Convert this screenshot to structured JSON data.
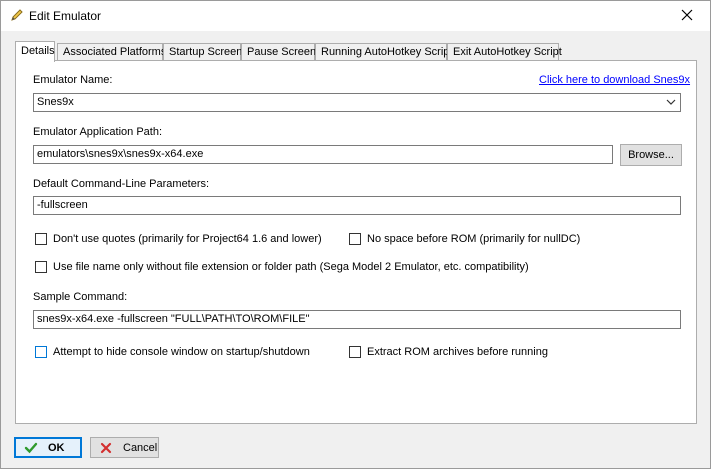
{
  "window": {
    "title": "Edit Emulator",
    "title_icon": "pencil-icon",
    "close_icon": "close-icon"
  },
  "tabs": [
    {
      "label": "Details",
      "active": true
    },
    {
      "label": "Associated Platforms",
      "active": false
    },
    {
      "label": "Startup Screen",
      "active": false
    },
    {
      "label": "Pause Screen",
      "active": false
    },
    {
      "label": "Running AutoHotkey Script",
      "active": false
    },
    {
      "label": "Exit AutoHotkey Script",
      "active": false
    }
  ],
  "details": {
    "emulator_name_label": "Emulator Name:",
    "download_link": "Click here to download Snes9x",
    "emulator_name_value": "Snes9x",
    "app_path_label": "Emulator Application Path:",
    "app_path_value": "emulators\\snes9x\\snes9x-x64.exe",
    "browse_label": "Browse...",
    "cmdline_label": "Default Command-Line Parameters:",
    "cmdline_value": "-fullscreen",
    "checkbox_no_quotes": "Don't use quotes (primarily for Project64 1.6 and lower)",
    "checkbox_no_space": "No space before ROM (primarily for nullDC)",
    "checkbox_file_name_only": "Use file name only without file extension or folder path (Sega Model 2 Emulator, etc. compatibility)",
    "sample_label": "Sample Command:",
    "sample_value": "snes9x-x64.exe -fullscreen \"FULL\\PATH\\TO\\ROM\\FILE\"",
    "checkbox_hide_console": "Attempt to hide console window on startup/shutdown",
    "checkbox_extract_rom": "Extract ROM archives before running"
  },
  "footer": {
    "ok_label": "OK",
    "cancel_label": "Cancel"
  },
  "colors": {
    "accent": "#0078d7",
    "link": "#0000ff",
    "ok_check": "#2e9a2e",
    "cancel_x": "#d32f2f"
  }
}
